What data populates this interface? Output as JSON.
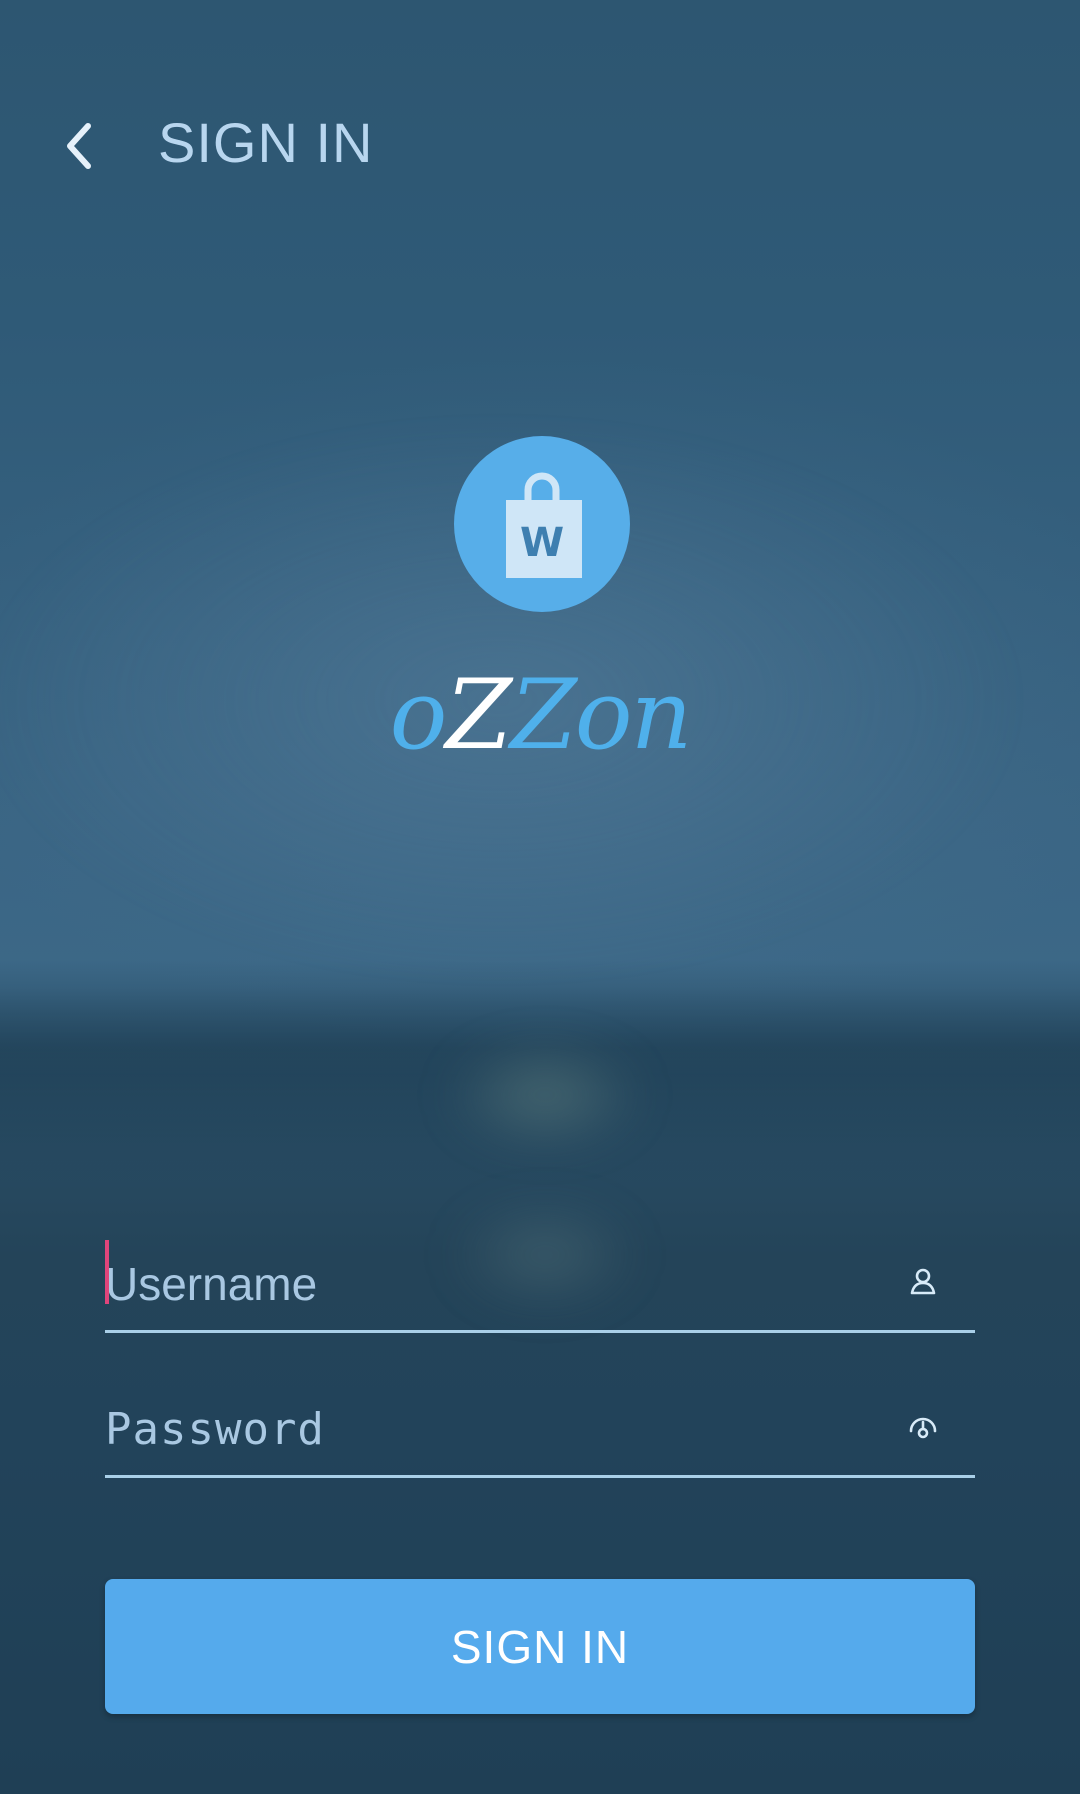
{
  "header": {
    "title": "SIGN IN",
    "back_icon": "chevron-left-icon"
  },
  "brand": {
    "logo_icon": "shopping-bag-icon",
    "logo_letter": "W",
    "name_parts": [
      "o",
      "Z",
      "Zon"
    ],
    "colors": {
      "accent": "#57aee9",
      "highlight": "#ffffff"
    }
  },
  "form": {
    "username": {
      "placeholder": "Username",
      "value": "",
      "icon": "user-icon"
    },
    "password": {
      "placeholder": "Password",
      "value": "",
      "icon": "password-visibility-icon"
    },
    "submit_label": "SIGN IN"
  },
  "colors": {
    "button": "#55aaec",
    "caret": "#e0457b",
    "underline": "#a9cfe8"
  }
}
